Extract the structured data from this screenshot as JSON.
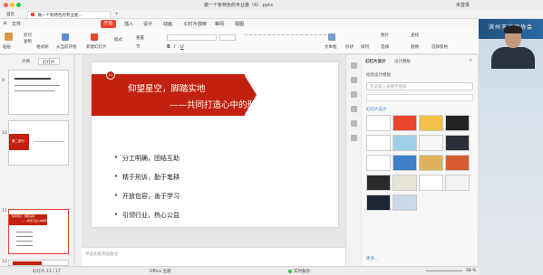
{
  "titlebar": {
    "title": "做一个有特色的专业委（4）.pptx",
    "user": "未登录"
  },
  "doc_tabs": [
    {
      "label": "首页"
    },
    {
      "label": "做一个有特色的专业委..."
    }
  ],
  "menu": {
    "items": [
      "文件",
      "开始",
      "插入",
      "设计",
      "动画",
      "幻灯片放映",
      "审阅",
      "视图"
    ],
    "active": "开始"
  },
  "ribbon": {
    "paste": "粘贴",
    "cut": "剪切",
    "copy": "复制",
    "format_painter": "格式刷",
    "from_current": "从当前开始",
    "new_slide": "新建幻灯片",
    "layout": "版式",
    "reset": "重置",
    "section": "节",
    "textbox": "文本框",
    "shape": "形状",
    "arrange": "排列",
    "picture": "图片",
    "find": "查找",
    "replace": "替换",
    "select": "选择",
    "select_pane": "选择窗格"
  },
  "left_panel": {
    "tab_outline": "大纲",
    "tab_slides": "幻灯片",
    "thumb_numbers": [
      "9",
      "10",
      "11",
      "12"
    ],
    "thumb10_text": "第二部分",
    "thumb11_line1": "仰望星空，脚踏实地",
    "thumb11_line2": "——共同打造心中的刑诉委"
  },
  "slide": {
    "badge": "11",
    "title_line1": "仰望星空，脚踏实地",
    "title_line2": "——共同打造心中的刑诉委",
    "bullets": [
      "分工明确，团结互助",
      "精于刑诉，勤于笔耕",
      "开放包容，善于学习",
      "引领行业，热心公益"
    ],
    "accent": "#c2210f"
  },
  "notes": {
    "placeholder": "单击此处添加备注"
  },
  "right_panel": {
    "tabs": [
      "幻灯片设计",
      "设计模板"
    ],
    "heading": "找到设计模板",
    "search_placeholder": "在此输入关键字搜索",
    "section": "幻灯片设计",
    "more": "更多..."
  },
  "statusbar": {
    "slide_info": "幻灯片 11 / 17",
    "theme": "Office 主题",
    "backup": "实时备份",
    "zoom": "58 %"
  },
  "webcam": {
    "logo": "滨州市律师协会"
  }
}
